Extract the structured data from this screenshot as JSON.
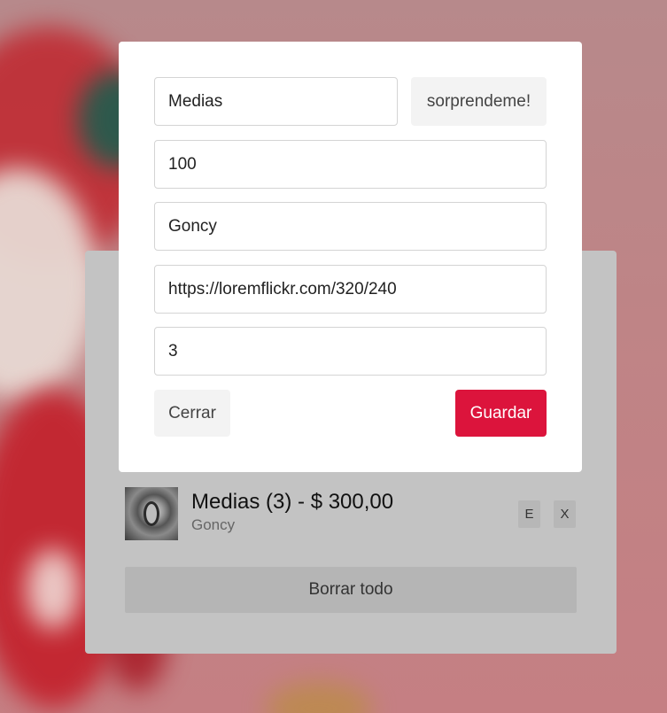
{
  "colors": {
    "accent": "#dc143c",
    "card_bg": "#c3c3c3",
    "modal_bg": "#ffffff"
  },
  "form": {
    "name_value": "Medias",
    "surprise_label": "sorprendeme!",
    "quantity_value": "100",
    "recipient_value": "Goncy",
    "image_url_value": "https://loremflickr.com/320/240",
    "count_value": "3",
    "close_label": "Cerrar",
    "save_label": "Guardar"
  },
  "list": {
    "items": [
      {
        "title": "Medias (3) - $ 300,00",
        "recipient": "Goncy",
        "edit_label": "E",
        "remove_label": "X",
        "thumbnail_icon": "image-thumbnail"
      }
    ],
    "clear_all_label": "Borrar todo"
  }
}
